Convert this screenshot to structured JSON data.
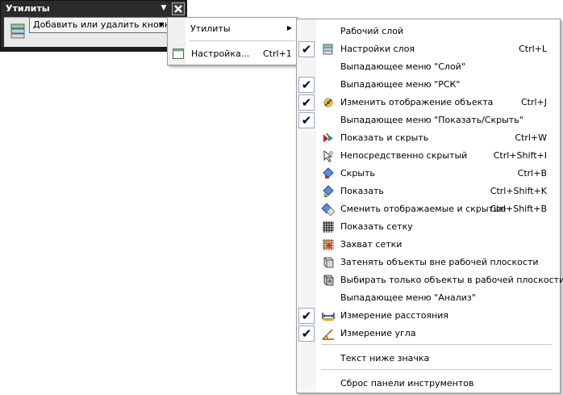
{
  "toolbar": {
    "title": "Утилиты",
    "add_remove_button": "Добавить или удалить кнопки"
  },
  "submenu": {
    "utilities": "Утилиты",
    "settings": "Настройка...",
    "settings_shortcut": "Ctrl+1"
  },
  "menu": {
    "items": [
      {
        "label": "Рабочий слой",
        "shortcut": "",
        "checked": false,
        "icon": "none"
      },
      {
        "label": "Настройки слоя",
        "shortcut": "Ctrl+L",
        "checked": true,
        "icon": "layer-settings-icon"
      },
      {
        "label": "Выпадающее меню \"Слой\"",
        "shortcut": "",
        "checked": false,
        "icon": "none"
      },
      {
        "label": "Выпадающее меню \"РСК\"",
        "shortcut": "",
        "checked": true,
        "icon": "none"
      },
      {
        "label": "Изменить отображение объекта",
        "shortcut": "Ctrl+J",
        "checked": true,
        "icon": "object-display-icon"
      },
      {
        "label": "Выпадающее меню \"Показать/Скрыть\"",
        "shortcut": "",
        "checked": true,
        "icon": "none"
      },
      {
        "label": "Показать и скрыть",
        "shortcut": "Ctrl+W",
        "checked": false,
        "icon": "show-hide-icon"
      },
      {
        "label": "Непосредственно скрытый",
        "shortcut": "Ctrl+Shift+I",
        "checked": false,
        "icon": "hide-direct-icon"
      },
      {
        "label": "Скрыть",
        "shortcut": "Ctrl+B",
        "checked": false,
        "icon": "hide-icon"
      },
      {
        "label": "Показать",
        "shortcut": "Ctrl+Shift+K",
        "checked": false,
        "icon": "show-icon"
      },
      {
        "label": "Сменить отображаемые и скрытые",
        "shortcut": "Ctrl+Shift+B",
        "checked": false,
        "icon": "swap-visible-icon"
      },
      {
        "label": "Показать сетку",
        "shortcut": "",
        "checked": false,
        "icon": "grid-icon"
      },
      {
        "label": "Захват сетки",
        "shortcut": "",
        "checked": false,
        "icon": "grid-snap-icon"
      },
      {
        "label": "Затенять объекты вне рабочей плоскости",
        "shortcut": "",
        "checked": false,
        "icon": "shade-objects-icon"
      },
      {
        "label": "Выбирать только объекты в рабочей плоскости",
        "shortcut": "",
        "checked": false,
        "icon": "select-workplane-icon"
      },
      {
        "label": "Выпадающее меню \"Анализ\"",
        "shortcut": "",
        "checked": false,
        "icon": "none"
      },
      {
        "label": "Измерение расстояния",
        "shortcut": "",
        "checked": true,
        "icon": "measure-distance-icon"
      },
      {
        "label": "Измерение угла",
        "shortcut": "",
        "checked": true,
        "icon": "measure-angle-icon"
      }
    ],
    "text_below_icon": "Текст ниже значка",
    "reset_toolbar": "Сброс панели инструментов"
  },
  "check_glyph": "✔"
}
